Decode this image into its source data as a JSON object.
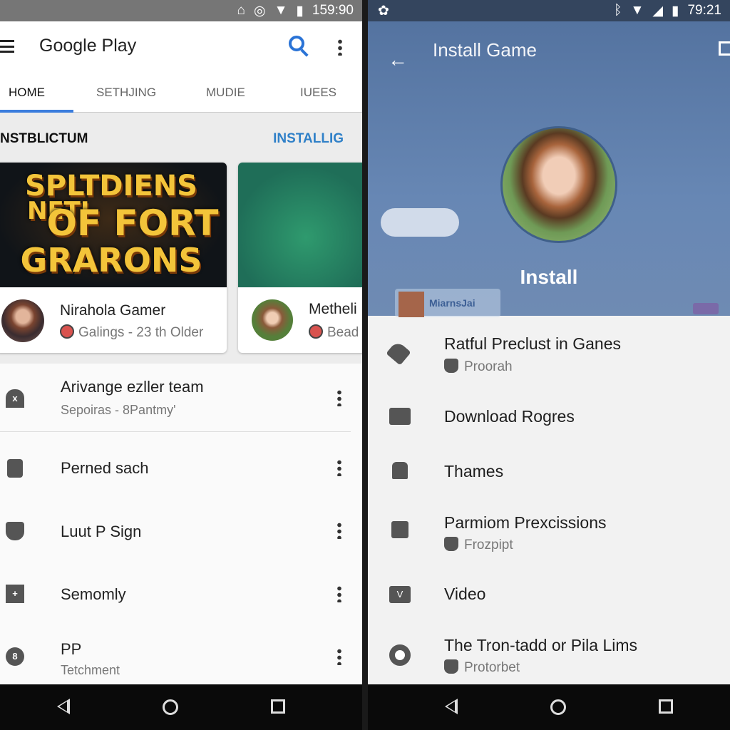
{
  "left": {
    "status_time": "159:90",
    "app_title": "Google Play",
    "tabs": [
      {
        "label": "HOME"
      },
      {
        "label": "SETHJING"
      },
      {
        "label": "MUDIE"
      },
      {
        "label": "IUEES"
      }
    ],
    "section_title": "NSTBLICTUM",
    "section_link": "INSTALLIG",
    "cards": [
      {
        "art_lines": [
          "SPLTDIENS",
          "NETI",
          "OF FORT",
          "GRARONS"
        ],
        "title": "Nirahola Gamer",
        "sub": "Galings  - 23 th Older"
      },
      {
        "title": "Metheli",
        "sub": "Bead"
      }
    ],
    "list": [
      {
        "icon": "house-x-icon",
        "title": "Arivange ezller team",
        "sub": "Sepoiras - 8Pantmy'"
      },
      {
        "icon": "bag-icon",
        "title": "Perned sach",
        "sub": ""
      },
      {
        "icon": "shield-icon",
        "title": "Luut P Sign",
        "sub": ""
      },
      {
        "icon": "building-icon",
        "title": "Semomly",
        "sub": ""
      },
      {
        "icon": "number-8-icon",
        "title": "PP",
        "sub": "Tetchment"
      }
    ]
  },
  "right": {
    "status_time": "79:21",
    "title": "Install Game",
    "install_label": "Install",
    "chip_text": "MiarnsJai",
    "list": [
      {
        "icon": "wrench-icon",
        "title": "Ratful Preclust in Ganes",
        "sub": "Proorah"
      },
      {
        "icon": "card-icon",
        "title": "Download Rogres",
        "sub": ""
      },
      {
        "icon": "hand-icon",
        "title": "Thames",
        "sub": ""
      },
      {
        "icon": "robot-icon",
        "title": "Parmiom Prexcissions",
        "sub": "Frozpipt"
      },
      {
        "icon": "video-icon",
        "title": "Video",
        "sub": ""
      },
      {
        "icon": "circle-icon",
        "title": "The Tron-tadd or Pila Lims",
        "sub": "Protorbet"
      }
    ]
  },
  "colors": {
    "accent": "#3b7ddd",
    "link": "#2f80c8",
    "hero": "#5a7aa6"
  }
}
